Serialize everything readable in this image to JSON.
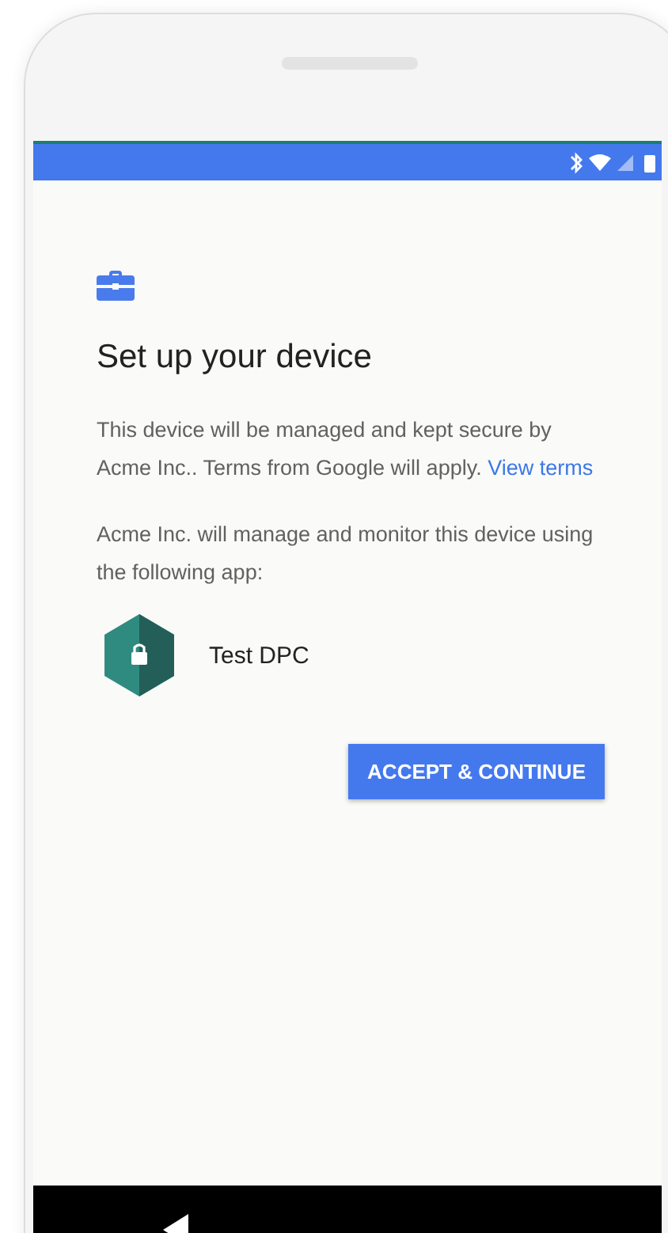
{
  "screen": {
    "title": "Set up your device",
    "paragraphs": [
      {
        "text": "This device will be managed and kept secure by Acme Inc.. Terms from Google will apply.",
        "link": "View terms"
      },
      {
        "text": "Acme Inc. will manage and monitor this device using the following app:"
      }
    ],
    "app": {
      "name": "Test DPC"
    },
    "button": "ACCEPT & CONTINUE"
  }
}
